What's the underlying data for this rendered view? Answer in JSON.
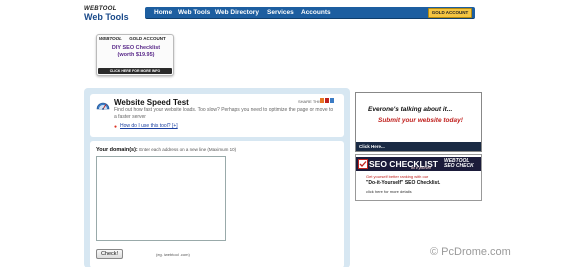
{
  "logo": {
    "top": "WEBTOOL",
    "bottom": "Web Tools"
  },
  "nav": {
    "items": [
      "Home",
      "Web Tools",
      "Web Directory",
      "Services",
      "Accounts"
    ],
    "gold_button": "GOLD ACCOUNT",
    "color": "#1d5ea0"
  },
  "gold_ad": {
    "brand": "WEBTOOL",
    "label": "GOLD ACCOUNT",
    "title": "DIY SEO Checklist",
    "price": "(worth $19.95)",
    "cta": "CLICK HERE FOR MORE INFO"
  },
  "tool": {
    "title": "Website Speed Test",
    "share": "SHARE THIS",
    "intro": "Find out how fast your website loads. Too slow? Perhaps you need to optimize the page or move to a faster server",
    "help": "How do I use this tool? [+]",
    "domain_label": "Your domain(s):",
    "domain_hint": "Enter each address on a new line (Maximum 10)",
    "domain_value": "",
    "check_button": "Check!",
    "example": "(eg. iwebtool .com)"
  },
  "banner1": {
    "line1": "Everone's talking about it...",
    "line2": "Submit your website today!",
    "footer": "Click Here..."
  },
  "banner2": {
    "title": "SEO CHECKLIST",
    "subtitle": "do it yourself",
    "brand": "WEBTOOL SEO CHECK",
    "line1": "Get yourself better ranking with our",
    "line2": "\"Do-it-Yourself\" SEO Checklist.",
    "line3": "click here for more details"
  },
  "watermark": "© PcDrome.com"
}
